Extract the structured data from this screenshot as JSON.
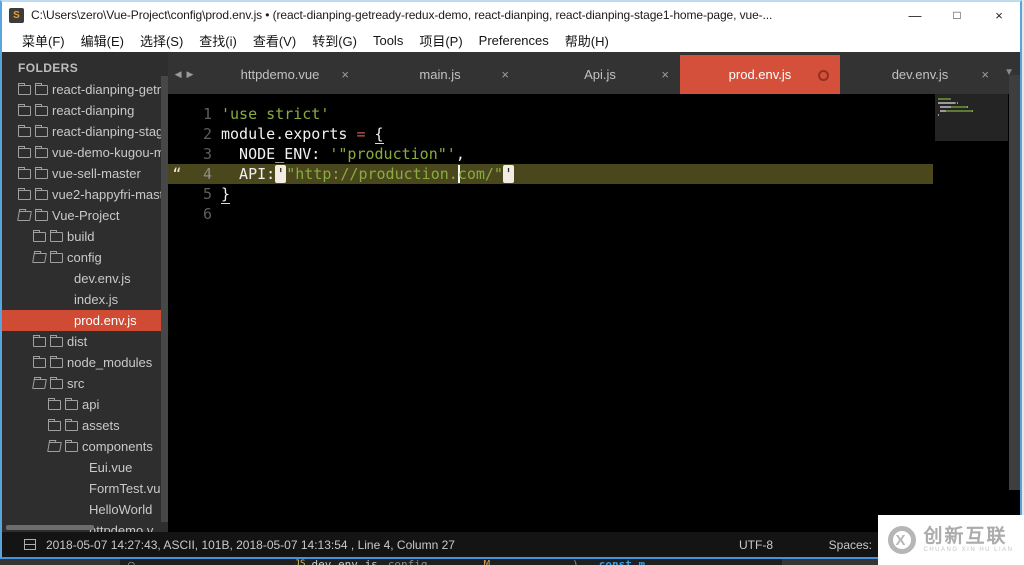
{
  "accent_colors": {
    "active_tab": "#d5503a",
    "sidebar_selection": "#d04b33",
    "line_highlight": "#4a471c",
    "string_green": "#8aab42",
    "window_border_blue": "#57a4de"
  },
  "window": {
    "title": "C:\\Users\\zero\\Vue-Project\\config\\prod.env.js • (react-dianping-getready-redux-demo, react-dianping, react-dianping-stage1-home-page, vue-...",
    "app_icon_letter": "S",
    "minimize_glyph": "—",
    "maximize_glyph": "□",
    "close_glyph": "×"
  },
  "menu": {
    "items": [
      "菜单(F)",
      "编辑(E)",
      "选择(S)",
      "查找(i)",
      "查看(V)",
      "转到(G)",
      "Tools",
      "项目(P)",
      "Preferences",
      "帮助(H)"
    ]
  },
  "sidebar": {
    "header": "FOLDERS",
    "items": [
      {
        "label": "react-dianping-getr",
        "indent": 0,
        "type": "folder",
        "open": false
      },
      {
        "label": "react-dianping",
        "indent": 0,
        "type": "folder",
        "open": false
      },
      {
        "label": "react-dianping-stag",
        "indent": 0,
        "type": "folder",
        "open": false
      },
      {
        "label": "vue-demo-kugou-m",
        "indent": 0,
        "type": "folder",
        "open": false
      },
      {
        "label": "vue-sell-master",
        "indent": 0,
        "type": "folder",
        "open": false
      },
      {
        "label": "vue2-happyfri-maste",
        "indent": 0,
        "type": "folder",
        "open": false
      },
      {
        "label": "Vue-Project",
        "indent": 0,
        "type": "folder",
        "open": true
      },
      {
        "label": "build",
        "indent": 1,
        "type": "folder",
        "open": false
      },
      {
        "label": "config",
        "indent": 1,
        "type": "folder",
        "open": true
      },
      {
        "label": "dev.env.js",
        "indent": 2,
        "type": "file",
        "selected": false
      },
      {
        "label": "index.js",
        "indent": 2,
        "type": "file",
        "selected": false
      },
      {
        "label": "prod.env.js",
        "indent": 2,
        "type": "file",
        "selected": true
      },
      {
        "label": "dist",
        "indent": 1,
        "type": "folder",
        "open": false
      },
      {
        "label": "node_modules",
        "indent": 1,
        "type": "folder",
        "open": false
      },
      {
        "label": "src",
        "indent": 1,
        "type": "folder",
        "open": true
      },
      {
        "label": "api",
        "indent": 2,
        "type": "folder",
        "open": false
      },
      {
        "label": "assets",
        "indent": 2,
        "type": "folder",
        "open": false
      },
      {
        "label": "components",
        "indent": 2,
        "type": "folder",
        "open": true
      },
      {
        "label": "Eui.vue",
        "indent": 3,
        "type": "file",
        "selected": false
      },
      {
        "label": "FormTest.vu",
        "indent": 3,
        "type": "file",
        "selected": false
      },
      {
        "label": "HelloWorld",
        "indent": 3,
        "type": "file",
        "selected": false
      },
      {
        "label": "httpdemo.v",
        "indent": 3,
        "type": "file",
        "selected": false
      }
    ]
  },
  "tabs": {
    "prev_glyph": "◀",
    "next_glyph": "▶",
    "overflow_glyph": "▼",
    "close_glyph": "×",
    "items": [
      {
        "label": "httpdemo.vue",
        "active": false,
        "dirty": false
      },
      {
        "label": "main.js",
        "active": false,
        "dirty": false
      },
      {
        "label": "Api.js",
        "active": false,
        "dirty": false
      },
      {
        "label": "prod.env.js",
        "active": true,
        "dirty": true
      },
      {
        "label": "dev.env.js",
        "active": false,
        "dirty": false
      }
    ]
  },
  "editor": {
    "gutter_change_glyph": "“",
    "lines": [
      {
        "num": "1",
        "highlight": false,
        "gutter": "",
        "segments": [
          {
            "t": "'use strict'",
            "c": "str"
          }
        ]
      },
      {
        "num": "2",
        "highlight": false,
        "gutter": "",
        "segments": [
          {
            "t": "module.exports ",
            "c": "def"
          },
          {
            "t": "=",
            "c": "op"
          },
          {
            "t": " ",
            "c": "def"
          },
          {
            "t": "{",
            "c": "brace"
          }
        ]
      },
      {
        "num": "3",
        "highlight": false,
        "gutter": "",
        "segments": [
          {
            "t": "  NODE_ENV: ",
            "c": "def"
          },
          {
            "t": "'\"production\"'",
            "c": "str"
          },
          {
            "t": ",",
            "c": "def"
          }
        ]
      },
      {
        "num": "4",
        "highlight": true,
        "gutter": "“",
        "segments": [
          {
            "t": "  API:",
            "c": "def"
          },
          {
            "t": "'",
            "c": "sel"
          },
          {
            "t": "\"http://production.",
            "c": "str"
          },
          {
            "t": "",
            "c": "cursor"
          },
          {
            "t": "com/\"",
            "c": "str"
          },
          {
            "t": "'",
            "c": "sel"
          }
        ]
      },
      {
        "num": "5",
        "highlight": false,
        "gutter": "",
        "segments": [
          {
            "t": "}",
            "c": "brace"
          }
        ]
      },
      {
        "num": "6",
        "highlight": false,
        "gutter": "",
        "segments": []
      }
    ]
  },
  "status_bar": {
    "left_text": "2018-05-07 14:27:43, ASCII, 101B, 2018-05-07 14:13:54 , Line 4, Column 27",
    "encoding": "UTF-8",
    "indent_label": "Spaces:"
  },
  "background_window_strip": {
    "tokens": [
      {
        "t": "○",
        "c": "circ"
      },
      {
        "t": "JS",
        "c": "js"
      },
      {
        "t": "dev.env.js",
        "c": "file"
      },
      {
        "t": "config",
        "c": "dim"
      },
      {
        "t": "M",
        "c": "mod"
      },
      {
        "t": ")",
        "c": "paren"
      },
      {
        "t": "const m",
        "c": "kw"
      }
    ]
  },
  "watermark": {
    "logo_letter": "X",
    "title": "创新互联",
    "subtitle": "CHUANG XIN HU LIAN"
  }
}
